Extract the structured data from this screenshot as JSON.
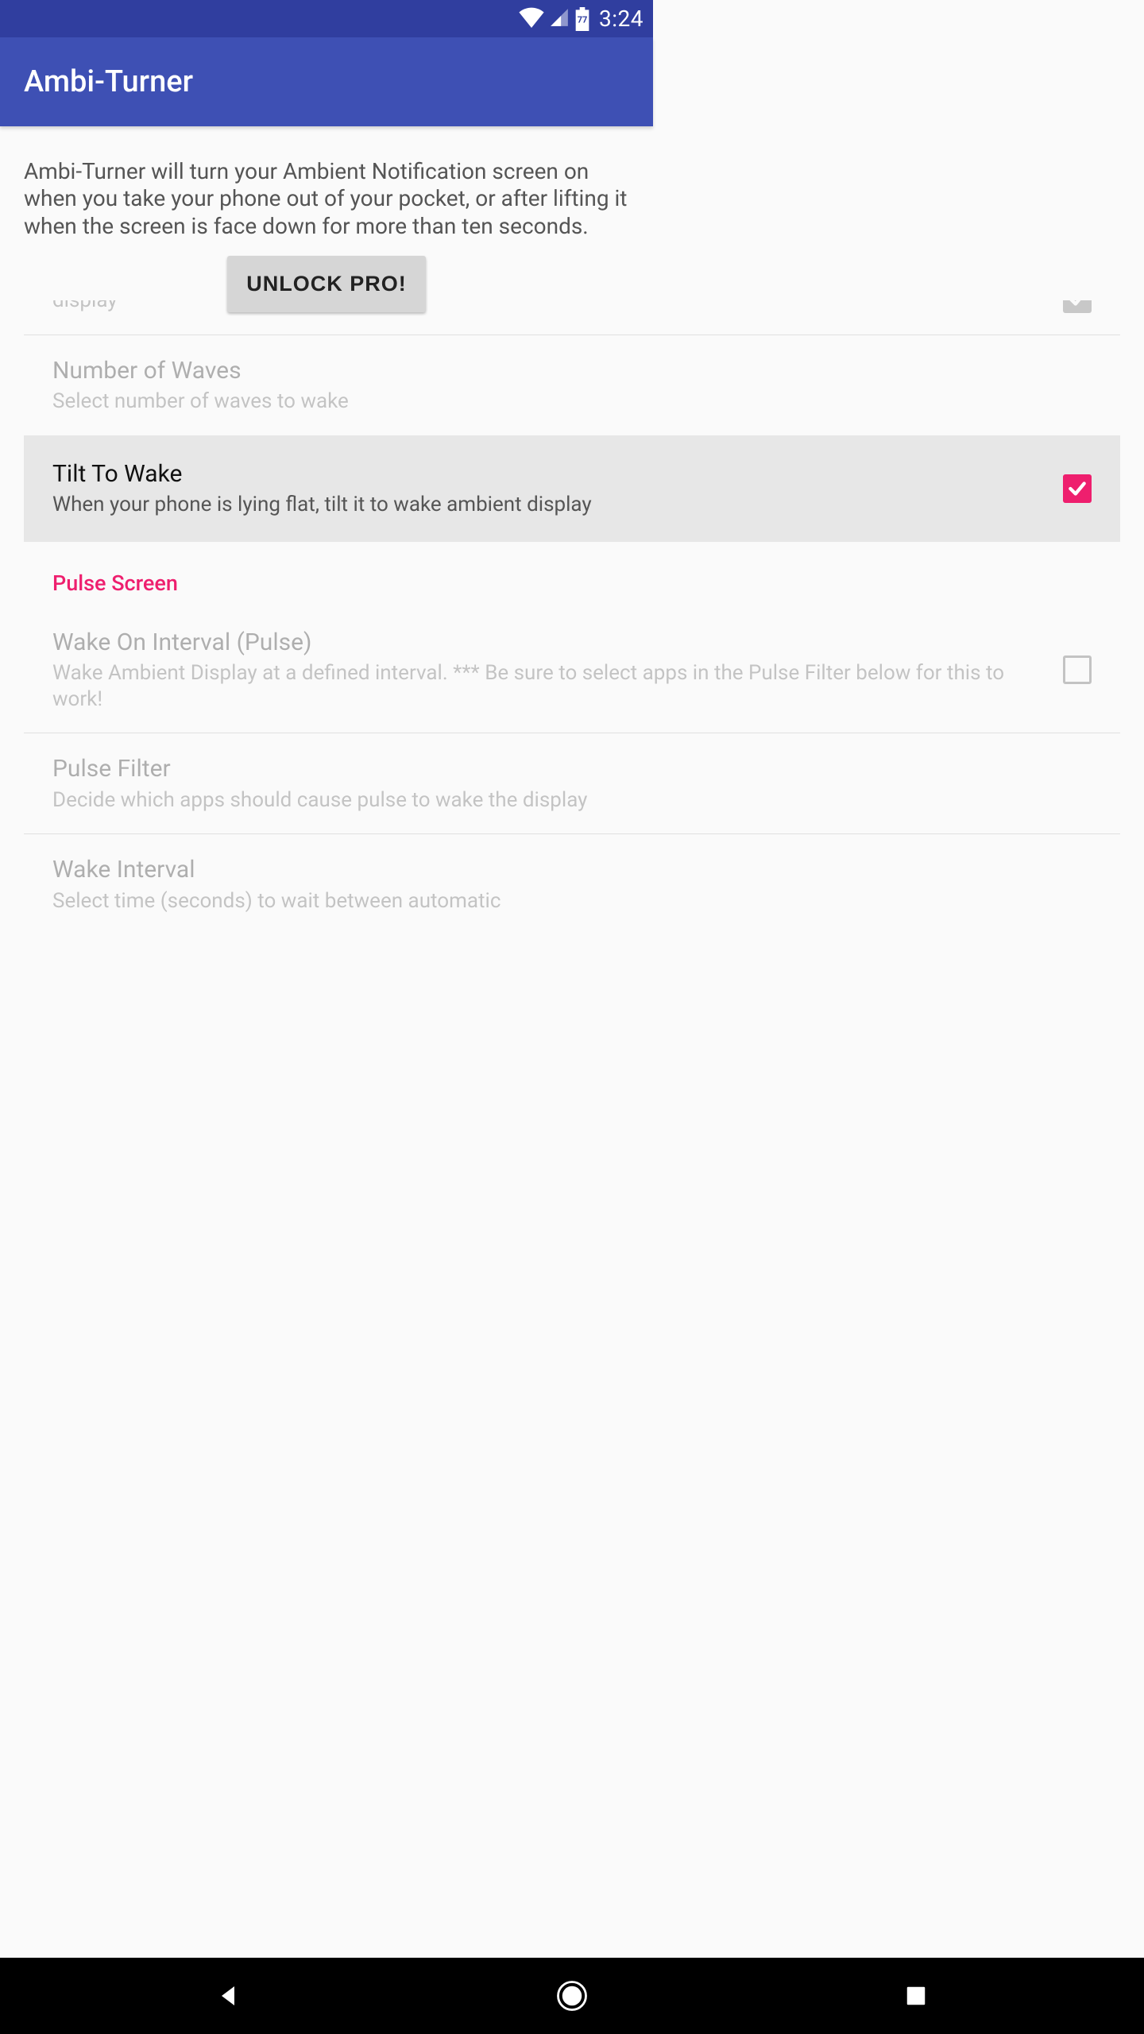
{
  "status": {
    "battery": "77",
    "time": "3:24"
  },
  "app": {
    "title": "Ambi-Turner"
  },
  "intro": "Ambi-Turner will turn your Ambient Notification screen on when you take your phone out of your pocket, or after lifting it when the screen is face down for more than ten seconds.",
  "unlock": {
    "label": "UNLOCK PRO!"
  },
  "settings": {
    "partial_top": {
      "sub": "display"
    },
    "waves": {
      "title": "Number of Waves",
      "sub": "Select number of waves to wake"
    },
    "tilt": {
      "title": "Tilt To Wake",
      "sub": "When your phone is lying flat, tilt it to wake ambient display"
    },
    "section1": "Pulse Screen",
    "wake_interval_pulse": {
      "title": "Wake On Interval (Pulse)",
      "sub": "Wake Ambient Display at a defined interval. *** Be sure to select apps in the Pulse Filter below for this to work!"
    },
    "pulse_filter": {
      "title": "Pulse Filter",
      "sub": "Decide which apps should cause pulse to wake the display"
    },
    "wake_interval": {
      "title": "Wake Interval",
      "sub": "Select time (seconds) to wait between automatic"
    }
  },
  "colors": {
    "status_bar": "#303e9f",
    "app_bar": "#3e50b4",
    "accent": "#ee1f6e"
  }
}
